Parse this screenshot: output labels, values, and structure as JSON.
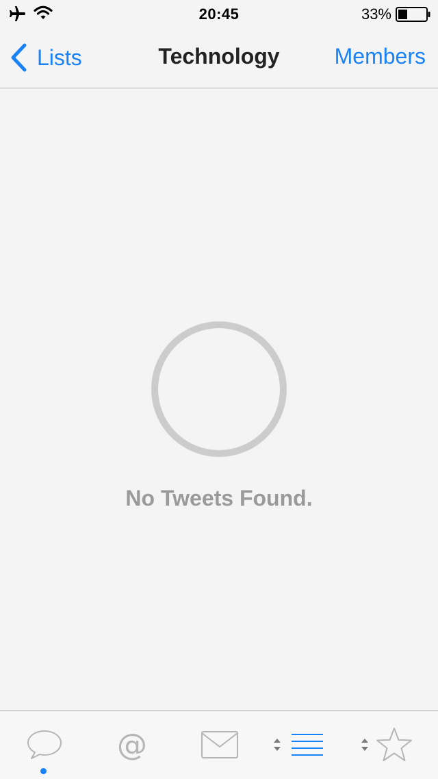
{
  "status_bar": {
    "time": "20:45",
    "battery_percent": "33%",
    "battery_level": 0.33,
    "icons": [
      "airplane-icon",
      "wifi-icon",
      "battery-icon"
    ]
  },
  "nav": {
    "back_label": "Lists",
    "title": "Technology",
    "right_label": "Members"
  },
  "empty_state": {
    "message": "No Tweets Found."
  },
  "tab_bar": {
    "tabs": [
      {
        "icon": "speech-bubble-icon",
        "active_dot": true
      },
      {
        "icon": "at-sign-icon"
      },
      {
        "icon": "envelope-icon"
      },
      {
        "icon": "list-icon",
        "selected": true
      },
      {
        "icon": "star-icon"
      }
    ]
  },
  "colors": {
    "accent": "#1a82f7",
    "background": "#f4f4f4",
    "muted_text": "#9a9a9a",
    "icon_gray": "#b5b5b5"
  }
}
